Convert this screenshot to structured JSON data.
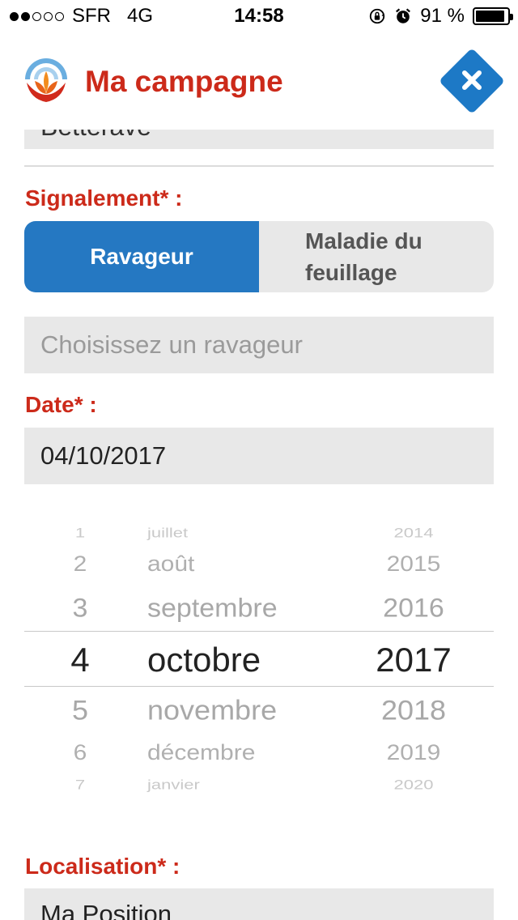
{
  "status_bar": {
    "carrier": "SFR",
    "network": "4G",
    "time": "14:58",
    "battery": "91 %",
    "battery_level": 0.91,
    "signal_bars": 2,
    "signal_total": 5
  },
  "header": {
    "title": "Ma campagne",
    "close_icon": "close-icon",
    "accent": "#cc2a1a",
    "close_color": "#1d79c6"
  },
  "form": {
    "cut_field_value": "Betterave",
    "signalement_label": "Signalement* :",
    "segments": [
      "Ravageur",
      "Maladie du feuillage"
    ],
    "selected_segment": "Ravageur",
    "ravageur_placeholder": "Choisissez un ravageur",
    "date_label": "Date* :",
    "date_value": "04/10/2017",
    "localisation_label": "Localisation* :",
    "localisation_value": "Ma Position"
  },
  "picker": {
    "days": [
      "1",
      "2",
      "3",
      "4",
      "5",
      "6",
      "7"
    ],
    "months": [
      "juillet",
      "août",
      "septembre",
      "octobre",
      "novembre",
      "décembre",
      "janvier"
    ],
    "years": [
      "2014",
      "2015",
      "2016",
      "2017",
      "2018",
      "2019",
      "2020"
    ],
    "selected_day": "4",
    "selected_month": "octobre",
    "selected_year": "2017"
  }
}
